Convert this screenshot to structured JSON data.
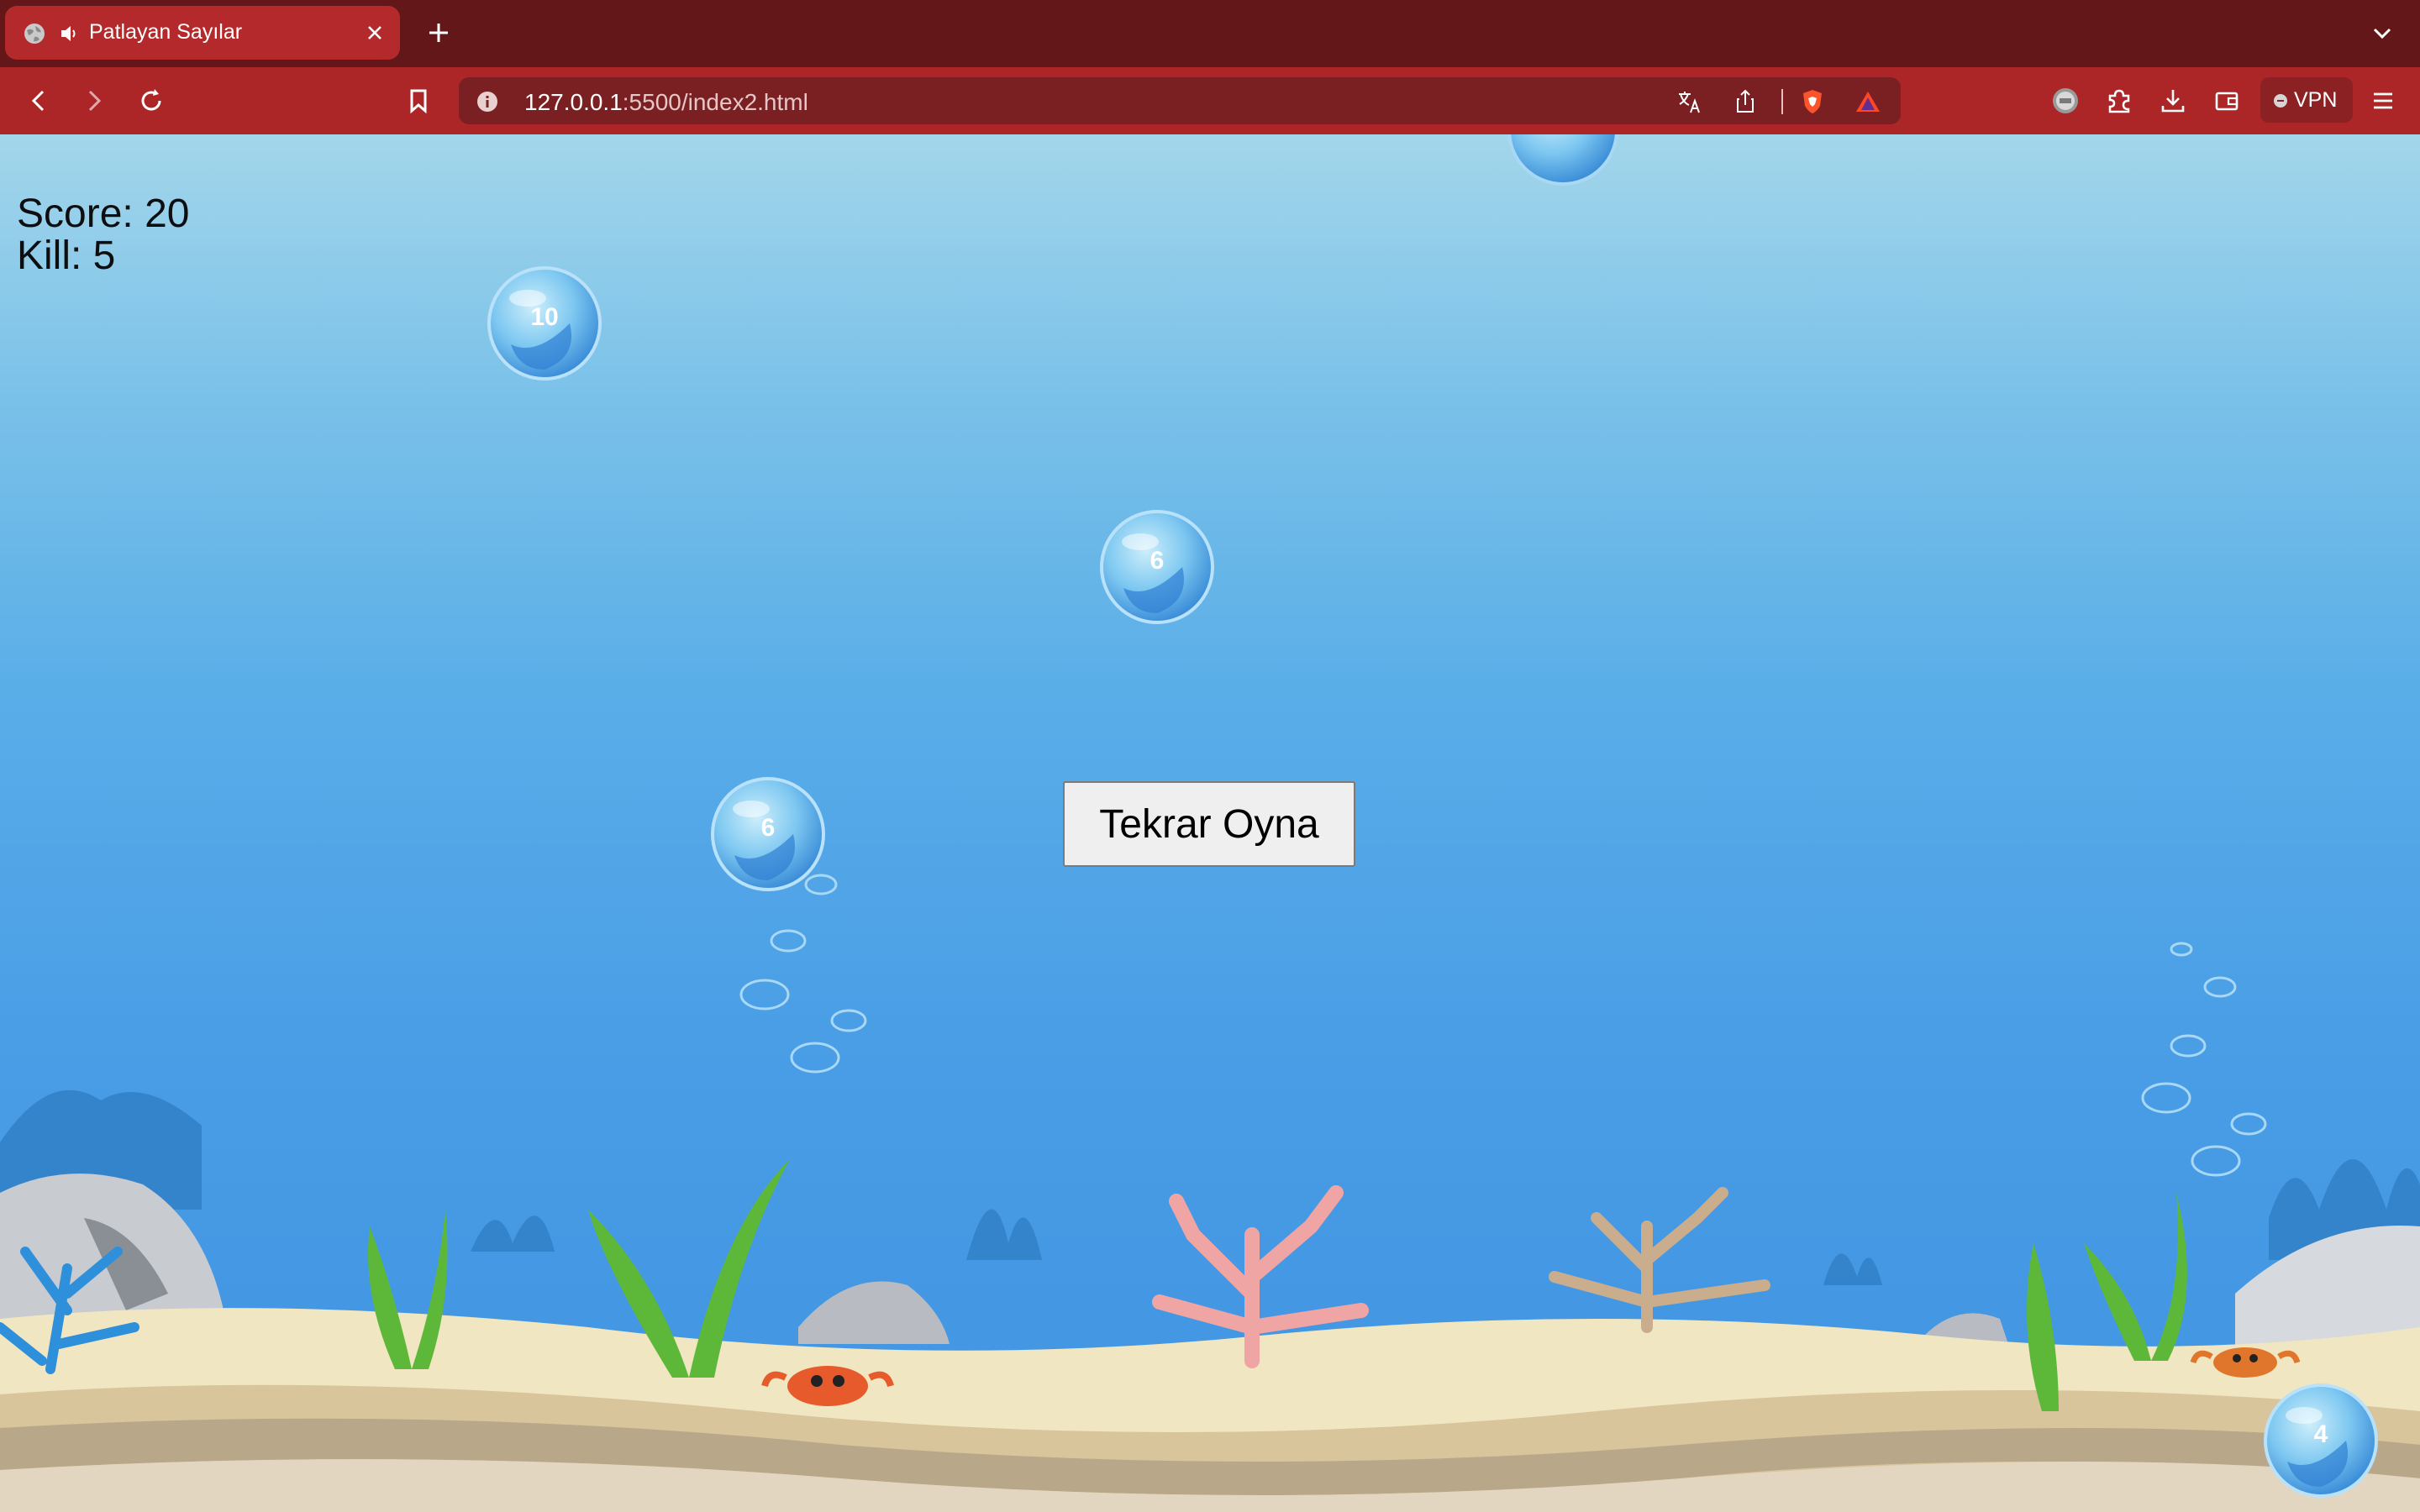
{
  "browser": {
    "tab": {
      "title": "Patlayan Sayılar"
    },
    "url": {
      "host": "127.0.0.1",
      "path": ":5500/index2.html"
    },
    "vpn_label": "VPN"
  },
  "game": {
    "score_label": "Score: 20",
    "kill_label": "Kill: 5",
    "replay_label": "Tekrar Oyna",
    "bubbles": [
      {
        "value": "10"
      },
      {
        "value": "6"
      },
      {
        "value": "6"
      },
      {
        "value": "4"
      }
    ]
  },
  "colors": {
    "tabbar": "#641718",
    "toolbar": "#ac2628",
    "active_tab": "#b42a2c",
    "urlbar": "#7b2022"
  },
  "icons": [
    "globe-icon",
    "speaker-icon",
    "close-icon",
    "plus-icon",
    "chevron-down-icon",
    "back-icon",
    "forward-icon",
    "reload-icon",
    "bookmark-icon",
    "info-icon",
    "translate-icon",
    "share-icon",
    "brave-shield-icon",
    "brave-rewards-icon",
    "extension-badge-icon",
    "puzzle-icon",
    "download-icon",
    "wallet-icon",
    "menu-icon"
  ]
}
